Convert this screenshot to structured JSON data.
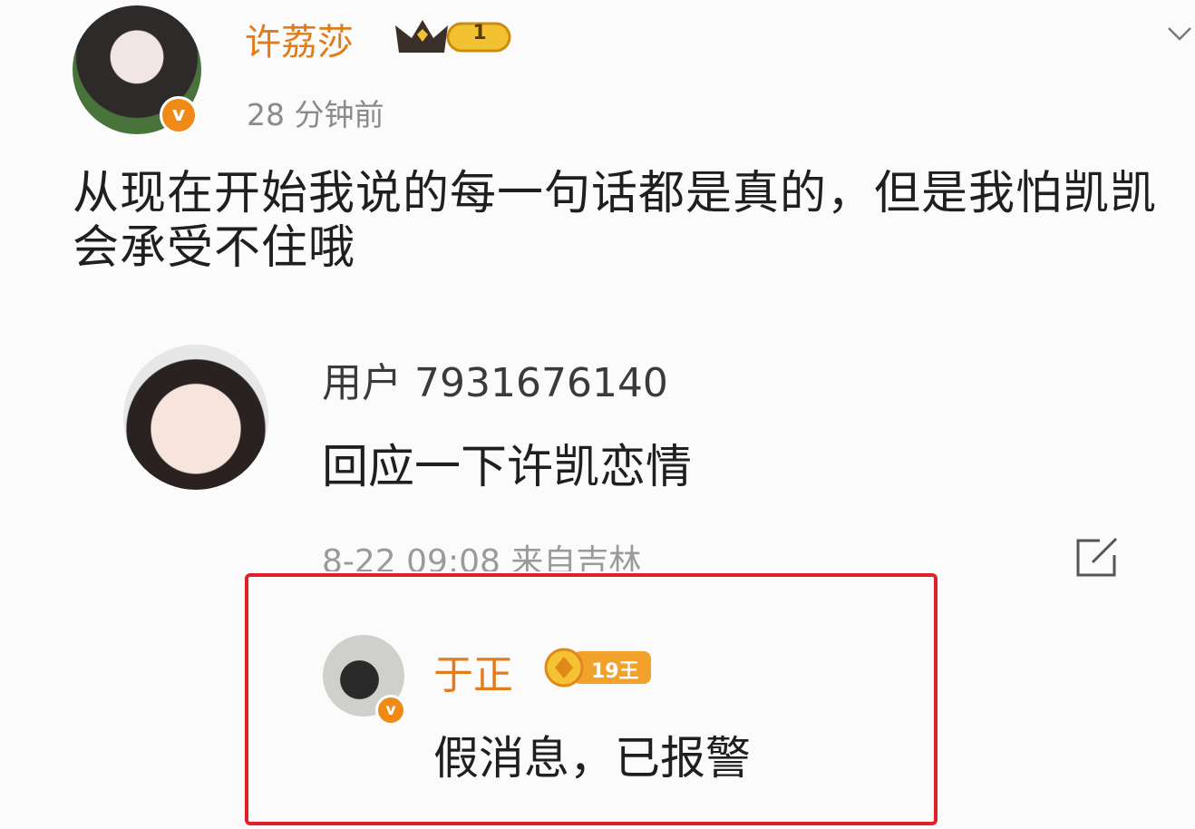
{
  "post": {
    "author": "许荔莎",
    "level": "1",
    "time": "28 分钟前",
    "text": "从现在开始我说的每一句话都是真的，但是我怕凯凯会承受不住哦"
  },
  "reply": {
    "username": "用户 7931676140",
    "text": "回应一下许凯恋情",
    "meta": "8-22 09:08 来自吉林"
  },
  "sub_reply": {
    "username": "于正",
    "badge_text": "19王",
    "text": "假消息，已报警"
  },
  "colors": {
    "username": "#e07c1c",
    "highlight_border": "#e0202a",
    "verified_badge": "#f08a16"
  },
  "icons": [
    "verified-v-icon",
    "crown-level-badge",
    "edit-icon",
    "chevron-down-icon",
    "fan-badge-icon"
  ]
}
